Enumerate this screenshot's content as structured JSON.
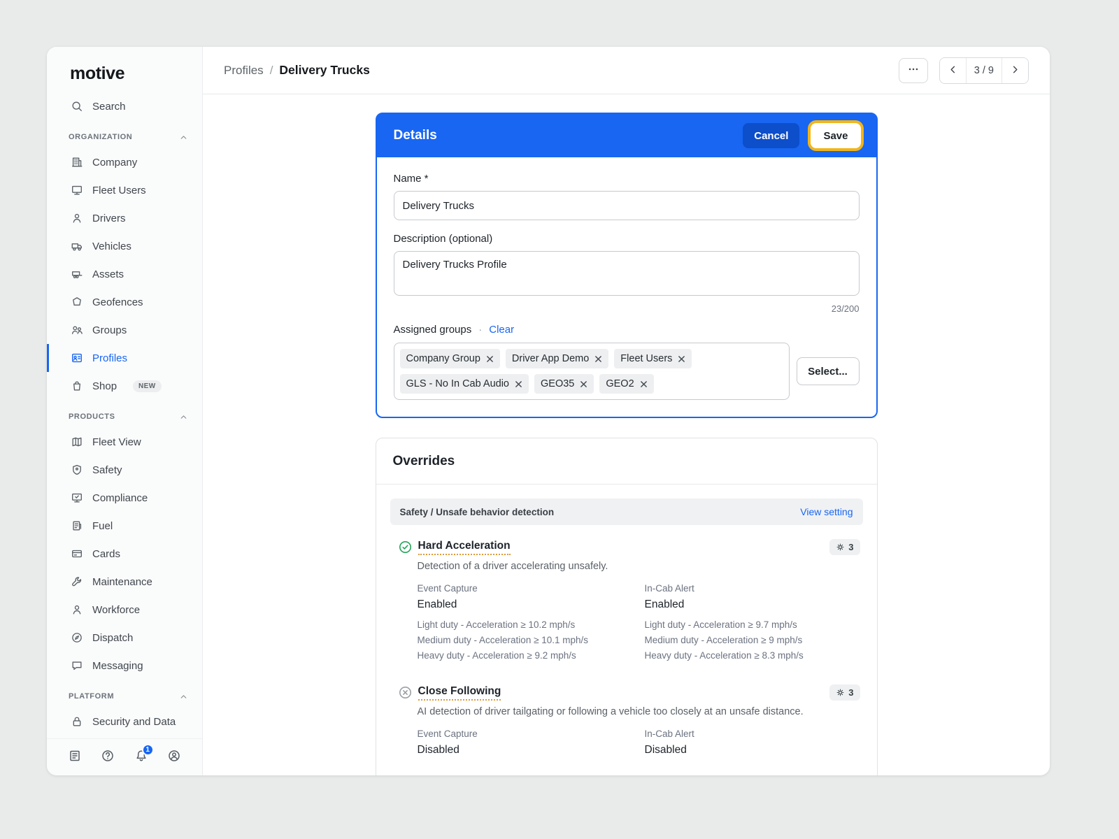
{
  "app": {
    "logo_text": "motive"
  },
  "colors": {
    "accent_blue": "#1866F2",
    "save_highlight_ring": "#F2B517",
    "enabled_green": "#24A35A",
    "disabled_gray": "#9AA0A6"
  },
  "icons": {
    "more_icon": "ellipsis",
    "prev_icon": "chevron-left",
    "next_icon": "chevron-right",
    "chip_remove_icon": "x-cross",
    "override_enabled_icon": "check-circle",
    "override_disabled_icon": "x-circle",
    "override_badge_icon": "gear"
  },
  "sidebar": {
    "search": "Search",
    "org_section": "ORGANIZATION",
    "org_items": [
      "Company",
      "Fleet Users",
      "Drivers",
      "Vehicles",
      "Assets",
      "Geofences",
      "Groups",
      "Profiles",
      "Shop"
    ],
    "shop_badge": "NEW",
    "products_section": "PRODUCTS",
    "product_items": [
      "Fleet View",
      "Safety",
      "Compliance",
      "Fuel",
      "Cards",
      "Maintenance",
      "Workforce",
      "Dispatch",
      "Messaging"
    ],
    "platform_section": "PLATFORM",
    "platform_items": [
      "Security and Data"
    ],
    "notification_count": "1"
  },
  "header": {
    "breadcrumb_root": "Profiles",
    "breadcrumb_sep": "/",
    "breadcrumb_current": "Delivery Trucks",
    "page_indicator": "3 / 9"
  },
  "details": {
    "title": "Details",
    "cancel_label": "Cancel",
    "save_label": "Save",
    "name_label": "Name *",
    "name_value": "Delivery Trucks",
    "description_label": "Description (optional)",
    "description_value": "Delivery Trucks Profile",
    "char_count": "23/200",
    "assigned_groups_label": "Assigned groups",
    "separator_dot": "·",
    "clear_label": "Clear",
    "select_label": "Select...",
    "chips": [
      "Company Group",
      "Driver App Demo",
      "Fleet Users",
      "GLS - No In Cab Audio",
      "GEO35",
      "GEO2"
    ]
  },
  "overrides": {
    "title": "Overrides",
    "section_label": "Safety / Unsafe behavior detection",
    "view_setting_label": "View setting",
    "items": [
      {
        "title": "Hard Acceleration",
        "status": "enabled",
        "badge_count": "3",
        "description": "Detection of a driver accelerating unsafely.",
        "event_capture_label": "Event Capture",
        "event_capture_value": "Enabled",
        "event_capture_lines": [
          "Light duty - Acceleration ≥ 10.2 mph/s",
          "Medium duty - Acceleration ≥ 10.1 mph/s",
          "Heavy duty - Acceleration ≥ 9.2 mph/s"
        ],
        "incab_label": "In-Cab Alert",
        "incab_value": "Enabled",
        "incab_lines": [
          "Light duty - Acceleration ≥ 9.7 mph/s",
          "Medium duty - Acceleration ≥ 9 mph/s",
          "Heavy duty - Acceleration ≥ 8.3 mph/s"
        ]
      },
      {
        "title": "Close Following",
        "status": "disabled",
        "badge_count": "3",
        "description": "AI detection of driver tailgating or following a vehicle too closely at an unsafe distance.",
        "event_capture_label": "Event Capture",
        "event_capture_value": "Disabled",
        "incab_label": "In-Cab Alert",
        "incab_value": "Disabled"
      }
    ]
  }
}
